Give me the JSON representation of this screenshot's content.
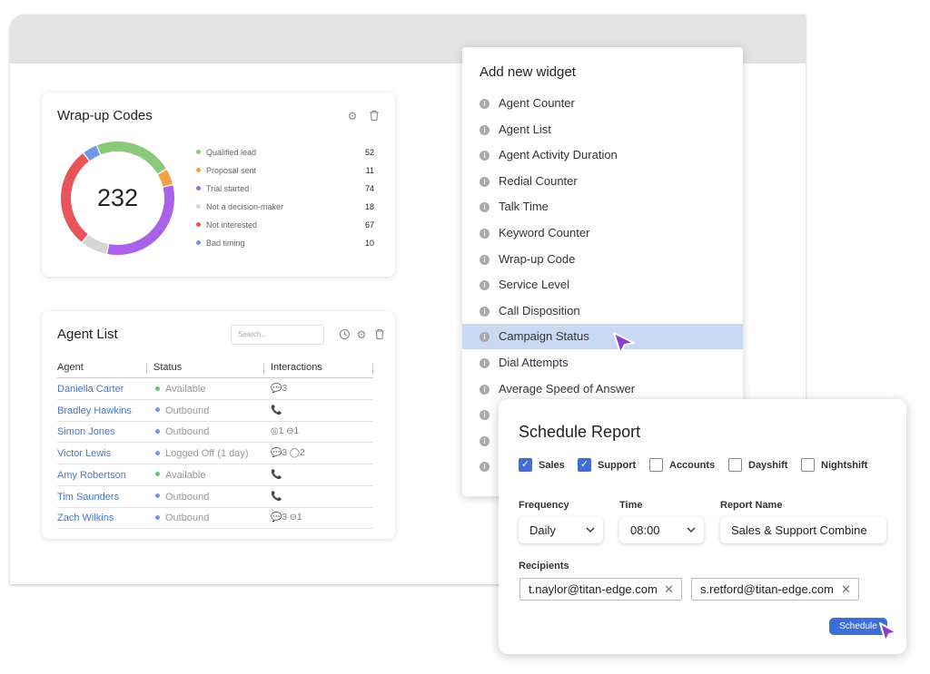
{
  "colors": {
    "accent": "#3f6ed8",
    "highlight": "#c9d9f3",
    "link": "#4a78c7",
    "cursor": "#8a3fcf"
  },
  "wrapup": {
    "title": "Wrap-up Codes",
    "total": "232",
    "items": [
      {
        "label": "Qualified lead",
        "value": 52,
        "color": "#8cc97a"
      },
      {
        "label": "Proposal sent",
        "value": 11,
        "color": "#f2a144"
      },
      {
        "label": "Trial started",
        "value": 74,
        "color": "#a863ea"
      },
      {
        "label": "Not a decision-maker",
        "value": 18,
        "color": "#d6d6d6"
      },
      {
        "label": "Not interested",
        "value": 67,
        "color": "#e8545a"
      },
      {
        "label": "Bad timing",
        "value": 10,
        "color": "#6f98e6"
      }
    ],
    "icons": [
      "gear-icon",
      "trash-icon"
    ]
  },
  "agent_list": {
    "title": "Agent List",
    "search_placeholder": "Search...",
    "columns": [
      "Agent",
      "Status",
      "Interactions"
    ],
    "rows": [
      {
        "agent": "Daniella Carter",
        "status": "Available",
        "status_color": "#6dbf6d",
        "interactions": "💬3"
      },
      {
        "agent": "Bradley Hawkins",
        "status": "Outbound",
        "status_color": "#6f98e6",
        "interactions": "📞"
      },
      {
        "agent": "Simon Jones",
        "status": "Outbound",
        "status_color": "#6f98e6",
        "interactions": "◎1   ⊖1"
      },
      {
        "agent": "Victor Lewis",
        "status": "Logged Off (1 day)",
        "status_color": "#6f98e6",
        "interactions": "💬3   ◯2"
      },
      {
        "agent": "Amy Robertson",
        "status": "Available",
        "status_color": "#6dbf6d",
        "interactions": "📞"
      },
      {
        "agent": "Tim Saunders",
        "status": "Outbound",
        "status_color": "#6f98e6",
        "interactions": "📞"
      },
      {
        "agent": "Zach Wilkins",
        "status": "Outbound",
        "status_color": "#6f98e6",
        "interactions": "💬3   ⊖1"
      }
    ]
  },
  "widget_panel": {
    "title": "Add new widget",
    "items": [
      "Agent Counter",
      "Agent List",
      "Agent Activity Duration",
      "Redial Counter",
      "Talk Time",
      "Keyword Counter",
      "Wrap-up Code",
      "Service Level",
      "Call Disposition",
      "Campaign Status",
      "Dial Attempts",
      "Average Speed of Answer"
    ],
    "highlighted": "Campaign Status"
  },
  "schedule": {
    "title": "Schedule Report",
    "checkboxes": [
      {
        "label": "Sales",
        "checked": true
      },
      {
        "label": "Support",
        "checked": true
      },
      {
        "label": "Accounts",
        "checked": false
      },
      {
        "label": "Dayshift",
        "checked": false
      },
      {
        "label": "Nightshift",
        "checked": false
      }
    ],
    "frequency_label": "Frequency",
    "frequency_value": "Daily",
    "time_label": "Time",
    "time_value": "08:00",
    "report_name_label": "Report Name",
    "report_name_value": "Sales & Support Combine",
    "recipients_label": "Recipients",
    "recipients": [
      "t.naylor@titan-edge.com",
      "s.retford@titan-edge.com"
    ],
    "button_label": "Schedule"
  }
}
